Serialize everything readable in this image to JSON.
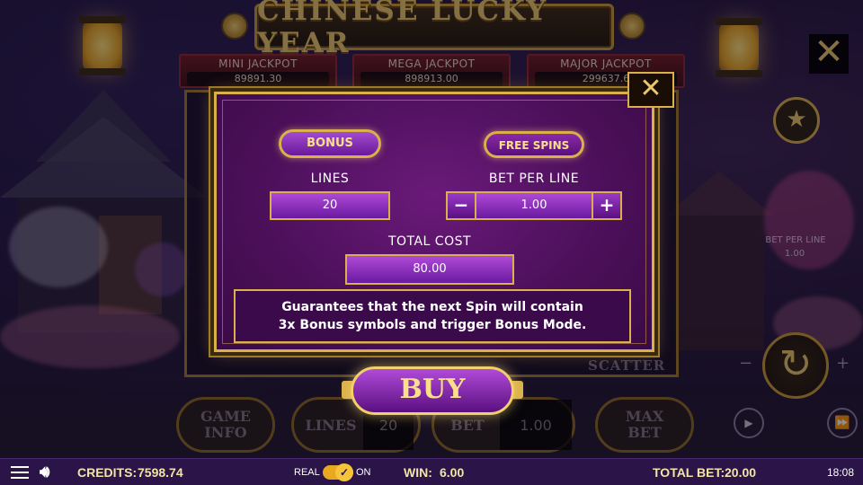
{
  "title": "CHINESE LUCKY YEAR",
  "jackpots": [
    {
      "label": "MINI JACKPOT",
      "value": "89891.30"
    },
    {
      "label": "MEGA JACKPOT",
      "value": "898913.00"
    },
    {
      "label": "MAJOR JACKPOT",
      "value": "299637.6"
    }
  ],
  "side": {
    "bet_per_line_label": "BET PER LINE",
    "bet_per_line_value": "1.00",
    "auto_label": "AUTO"
  },
  "reels": {
    "scatter_label": "SCATTER"
  },
  "bottom": {
    "game_info": "GAME INFO",
    "lines_label": "LINES",
    "lines_value": "20",
    "bet_label": "BET",
    "bet_value": "1.00",
    "max_bet": "MAX BET"
  },
  "modal": {
    "tab_bonus": "BONUS",
    "tab_free_spins": "FREE SPINS",
    "lines_label": "LINES",
    "lines_value": "20",
    "bet_per_line_label": "BET PER LINE",
    "bet_per_line_value": "1.00",
    "minus": "−",
    "plus": "+",
    "total_cost_label": "TOTAL  COST",
    "total_cost_value": "80.00",
    "description_line1": "Guarantees that the next Spin will contain",
    "description_line2": "3x Bonus symbols and trigger Bonus Mode.",
    "buy_label": "BUY"
  },
  "statusbar": {
    "credits_label": "CREDITS:",
    "credits_value": "7598.74",
    "real_label": "REAL",
    "on_label": "ON",
    "win_label": "WIN:",
    "win_value": "6.00",
    "total_bet_label": "TOTAL BET:",
    "total_bet_value": "20.00",
    "clock": "18:08"
  },
  "colors": {
    "gold": "#d9b04a",
    "purple": "#6a1a7a",
    "statusbar": "#2a1448",
    "toggle": "#e9a820"
  }
}
